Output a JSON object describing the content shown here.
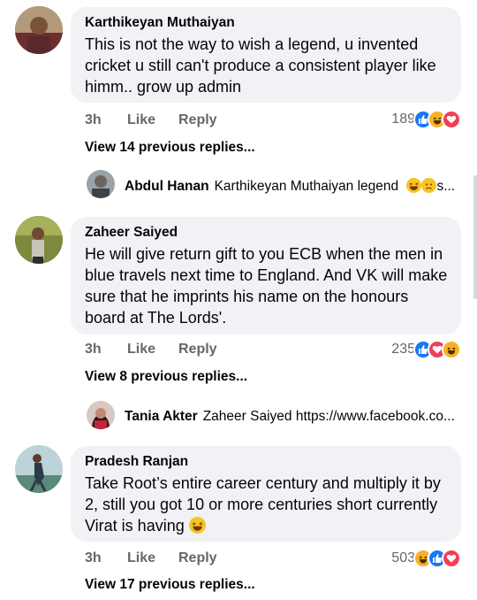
{
  "comments": [
    {
      "author": "Karthikeyan Muthaiyan",
      "text": "This is not the way to wish a legend, u invented cricket u still can't produce a consistent player like himm.. grow up admin",
      "time": "3h",
      "like_label": "Like",
      "reply_label": "Reply",
      "reaction_count": "189",
      "reactions": [
        "like-icon",
        "haha-icon",
        "love-icon"
      ],
      "view_replies": "View 14 previous replies...",
      "reply_preview": {
        "author": "Abdul Hanan",
        "text": "Karthikeyan Muthaiyan legend",
        "suffix": "s..."
      }
    },
    {
      "author": "Zaheer Saiyed",
      "text": "He will give return gift to you ECB when the men in blue travels next time to England. And VK will make sure that he imprints his name on the honours board at The Lords'.",
      "time": "3h",
      "like_label": "Like",
      "reply_label": "Reply",
      "reaction_count": "235",
      "reactions": [
        "like-icon",
        "love-icon",
        "haha-icon"
      ],
      "view_replies": "View 8 previous replies...",
      "reply_preview": {
        "author": "Tania Akter",
        "text": "Zaheer Saiyed https://www.facebook.co..."
      }
    },
    {
      "author": "Pradesh Ranjan",
      "text": "Take Root’s entire career century and multiply it by 2, still you got 10 or more centuries short currently Virat is having",
      "time": "3h",
      "like_label": "Like",
      "reply_label": "Reply",
      "reaction_count": "503",
      "reactions": [
        "haha-icon",
        "like-icon",
        "love-icon"
      ],
      "view_replies": "View 17 previous replies..."
    }
  ],
  "colors": {
    "bubble": "#f0f2f5",
    "meta": "#65676b",
    "like": "#1877f2",
    "love": "#f33e58",
    "haha": "#f7b125"
  }
}
